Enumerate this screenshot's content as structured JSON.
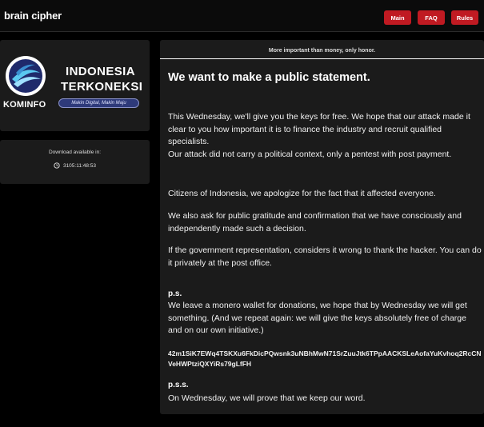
{
  "header": {
    "brand": "brain cipher",
    "nav": {
      "main": "Main",
      "faq": "FAQ",
      "rules": "Rules"
    }
  },
  "logo": {
    "caption": "KOMINFO",
    "line1": "INDONESIA",
    "line2": "TERKONEKSI",
    "tagline": "Makin Digital, Makin Maju"
  },
  "download": {
    "label": "Download available in:",
    "timer": "3105:11:48:53"
  },
  "statement": {
    "motto": "More important than money, only honor.",
    "title": "We want to make a public statement.",
    "p1": "This Wednesday, we'll give you the keys for free. We hope that our attack made it clear to you how important it is to finance the industry and recruit qualified specialists.",
    "p2": "Our attack did not carry a political context, only a pentest with post payment.",
    "p3": "Citizens of Indonesia, we apologize for the fact that it affected everyone.",
    "p4": "We also ask for public gratitude and confirmation that we have consciously and independently made such a decision.",
    "p5": "If the government representation, considers it wrong to thank the hacker. You can do it privately at the post office.",
    "ps_label": "p.s.",
    "ps_text": "We leave a monero wallet for donations, we hope that by Wednesday we will get something. (And we repeat again: we will give the keys absolutely free of charge and on our own initiative.)",
    "wallet": "42m1SiK7EWq4TSKXu6FkDicPQwsnk3uNBhMwN71SrZuuJtk6TPpAACKSLeAofaYuKvhoq2RcCNVeHWPtziQXYiRs79gLfFH",
    "pss_label": "p.s.s.",
    "pss_text": "On Wednesday, we will prove that we keep our word."
  },
  "colors": {
    "accent": "#c01a22",
    "card": "#1b1b1b",
    "background": "#000000"
  }
}
